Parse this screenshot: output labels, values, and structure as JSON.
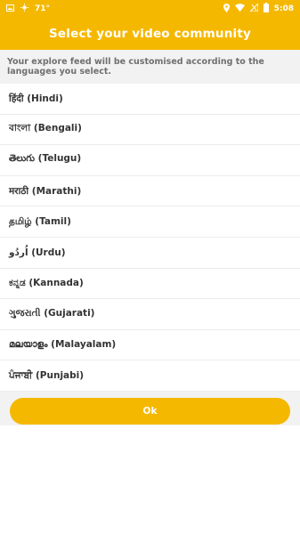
{
  "status_bar": {
    "temperature": "71°",
    "time": "5:08",
    "icons": [
      "photo-icon",
      "sun-icon",
      "location-icon",
      "wifi-icon",
      "no-signal-icon",
      "battery-icon"
    ]
  },
  "header": {
    "title": "Select your video community"
  },
  "info": {
    "text": "Your explore feed will be customised according to the languages you select."
  },
  "languages": [
    {
      "label": "हिंदी (Hindi)"
    },
    {
      "label": "বাংলা (Bengali)"
    },
    {
      "label": "తెలుగు (Telugu)"
    },
    {
      "label": "मराठी (Marathi)"
    },
    {
      "label": "தமிழ் (Tamil)"
    },
    {
      "label": "اُردُو (Urdu)"
    },
    {
      "label": "ಕನ್ನಡ (Kannada)"
    },
    {
      "label": "ગુજરાતી (Gujarati)"
    },
    {
      "label": "മലയാളം (Malayalam)"
    },
    {
      "label": "ਪੰਜਾਬੀ (Punjabi)"
    }
  ],
  "ok_button": {
    "label": "Ok"
  },
  "colors": {
    "accent": "#f5b800",
    "info_bg": "#f2f2f2"
  }
}
